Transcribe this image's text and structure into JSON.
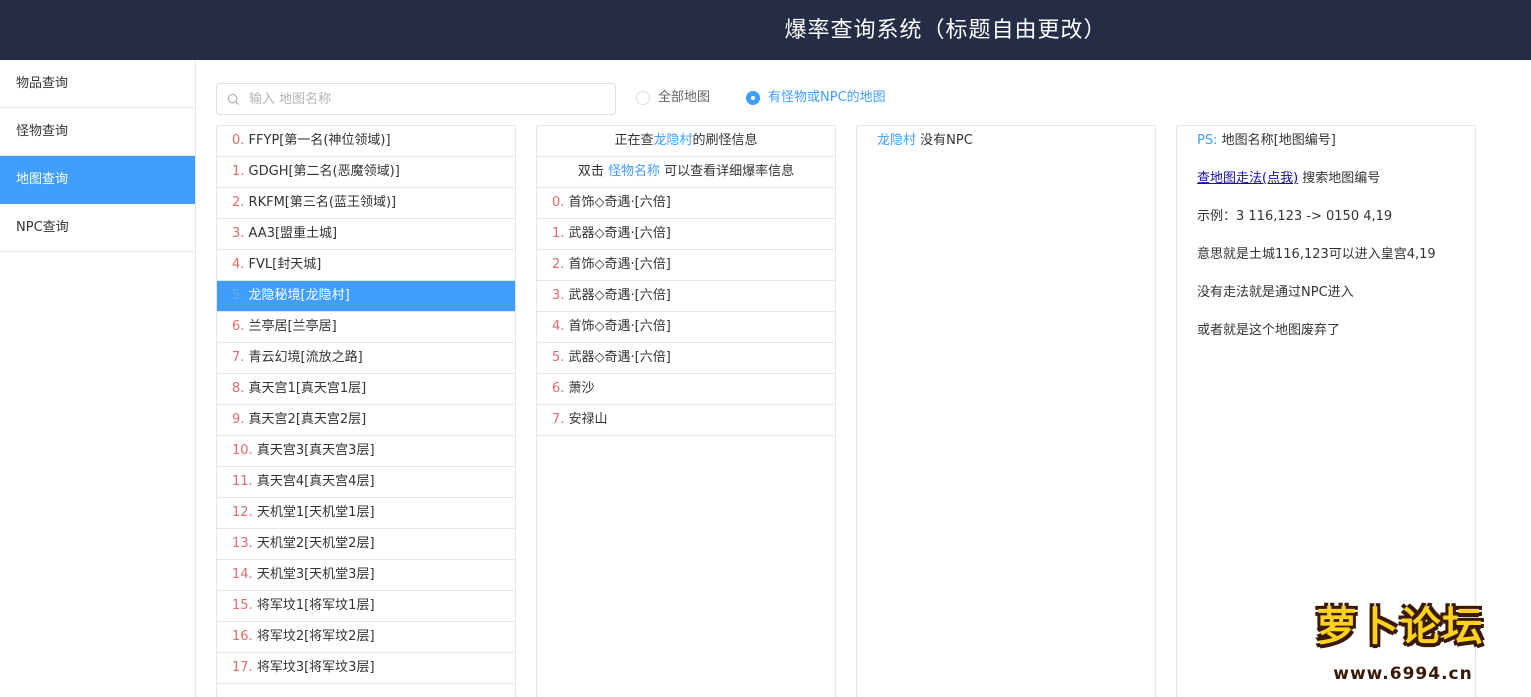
{
  "header": {
    "title": "爆率查询系统（标题自由更改）"
  },
  "sidebar": {
    "items": [
      {
        "label": "物品查询"
      },
      {
        "label": "怪物查询"
      },
      {
        "label": "地图查询"
      },
      {
        "label": "NPC查询"
      }
    ],
    "active_index": 2
  },
  "search": {
    "placeholder": "输入 地图名称",
    "value": ""
  },
  "filters": {
    "options": [
      "全部地图",
      "有怪物或NPC的地图"
    ],
    "selected": "有怪物或NPC的地图"
  },
  "maps": {
    "selected_index": 5,
    "items": [
      {
        "idx": "0.",
        "name": "FFYP[第一名(神位领域)]"
      },
      {
        "idx": "1.",
        "name": "GDGH[第二名(恶魔领域)]"
      },
      {
        "idx": "2.",
        "name": "RKFM[第三名(蓝王领域)]"
      },
      {
        "idx": "3.",
        "name": "AA3[盟重土城]"
      },
      {
        "idx": "4.",
        "name": "FVL[封天城]"
      },
      {
        "idx": "5.",
        "name": "龙隐秘境[龙隐村]"
      },
      {
        "idx": "6.",
        "name": "兰亭居[兰亭居]"
      },
      {
        "idx": "7.",
        "name": "青云幻境[流放之路]"
      },
      {
        "idx": "8.",
        "name": "真天宫1[真天宫1层]"
      },
      {
        "idx": "9.",
        "name": "真天宫2[真天宫2层]"
      },
      {
        "idx": "10.",
        "name": "真天宫3[真天宫3层]"
      },
      {
        "idx": "11.",
        "name": "真天宫4[真天宫4层]"
      },
      {
        "idx": "12.",
        "name": "天机堂1[天机堂1层]"
      },
      {
        "idx": "13.",
        "name": "天机堂2[天机堂2层]"
      },
      {
        "idx": "14.",
        "name": "天机堂3[天机堂3层]"
      },
      {
        "idx": "15.",
        "name": "将军坟1[将军坟1层]"
      },
      {
        "idx": "16.",
        "name": "将军坟2[将军坟2层]"
      },
      {
        "idx": "17.",
        "name": "将军坟3[将军坟3层]"
      }
    ]
  },
  "monsters": {
    "header_prefix": "正在查",
    "header_map": "龙隐村",
    "header_suffix": "的刷怪信息",
    "hint_prefix": "双击",
    "hint_link": "怪物名称",
    "hint_suffix": "可以查看详细爆率信息",
    "items": [
      {
        "idx": "0.",
        "name": "首饰◇奇遇·[六倍]"
      },
      {
        "idx": "1.",
        "name": "武器◇奇遇·[六倍]"
      },
      {
        "idx": "2.",
        "name": "首饰◇奇遇·[六倍]"
      },
      {
        "idx": "3.",
        "name": "武器◇奇遇·[六倍]"
      },
      {
        "idx": "4.",
        "name": "首饰◇奇遇·[六倍]"
      },
      {
        "idx": "5.",
        "name": "武器◇奇遇·[六倍]"
      },
      {
        "idx": "6.",
        "name": "萧沙"
      },
      {
        "idx": "7.",
        "name": "安禄山"
      }
    ]
  },
  "npc": {
    "map": "龙隐村",
    "text": "没有NPC"
  },
  "info": {
    "ps_label": "PS:",
    "ps_text": "地图名称[地图编号]",
    "link_text": "查地图走法(点我)",
    "link_suffix": "搜索地图编号",
    "example": "示例：3 116,123 -> 0150 4,19",
    "meaning": "意思就是土城116,123可以进入皇宫4,19",
    "no_route": "没有走法就是通过NPC进入",
    "abandoned": "或者就是这个地图废弃了"
  },
  "watermark": {
    "logo": "萝卜论坛",
    "url": "www.6994.cn"
  },
  "colors": {
    "header_bg": "#242c46",
    "accent": "#409eff",
    "index_red": "#e06c6c"
  }
}
